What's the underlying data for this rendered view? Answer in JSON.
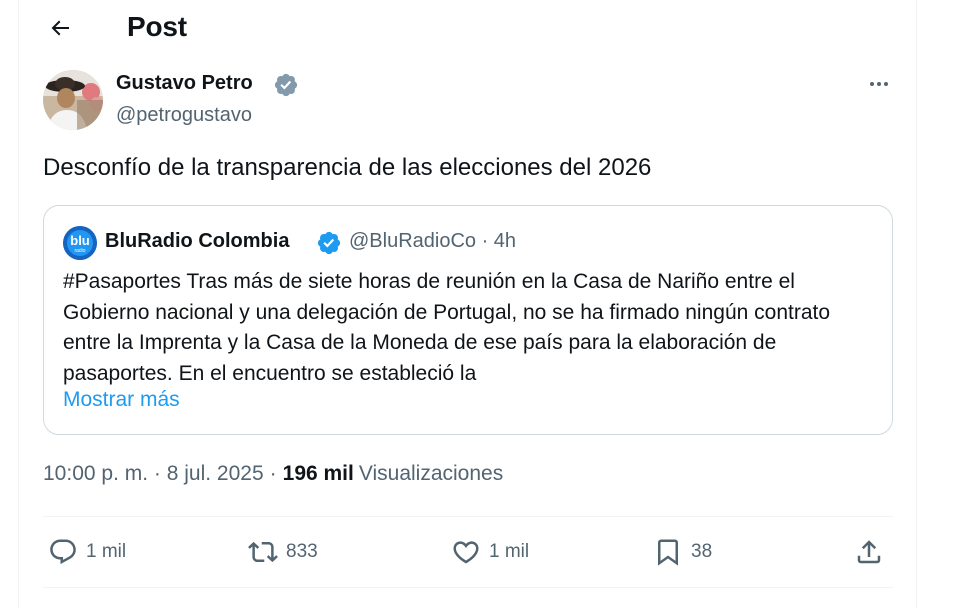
{
  "header": {
    "title": "Post",
    "back_icon": "arrow-left-icon"
  },
  "author": {
    "name": "Gustavo Petro",
    "handle": "@petrogustavo",
    "verified_icon": "verified-badge-icon",
    "badge_color": "#829aab"
  },
  "post": {
    "text": "Desconfío de la transparencia de las elecciones del 2026",
    "timestamp": "10:00 p. m. · 8 jul. 2025",
    "sep": "·",
    "views_count": "196 mil",
    "views_label": "Visualizaciones"
  },
  "quote": {
    "name": "BluRadio Colombia",
    "logo_text": "blu",
    "logo_subtext": "radio",
    "handle": "@BluRadioCo",
    "time": "· 4h",
    "badge_color": "#1d9bf0",
    "body": "#Pasaportes Tras más de siete horas de reunión en la Casa de Nariño entre el Gobierno nacional y una delegación de Portugal, no se ha firmado ningún contrato entre la Imprenta y la Casa de la Moneda de ese país para la elaboración de pasaportes. En el encuentro se estableció la",
    "show_more": "Mostrar más"
  },
  "actions": {
    "replies": {
      "icon": "reply-icon",
      "count": "1 mil"
    },
    "reposts": {
      "icon": "repost-icon",
      "count": "833"
    },
    "likes": {
      "icon": "heart-icon",
      "count": "1 mil"
    },
    "bookmarks": {
      "icon": "bookmark-icon",
      "count": "38"
    },
    "share": {
      "icon": "share-icon"
    }
  },
  "colors": {
    "text": "#0f1419",
    "secondary": "#536471",
    "link": "#1d9bf0",
    "border": "#cfd9de"
  }
}
